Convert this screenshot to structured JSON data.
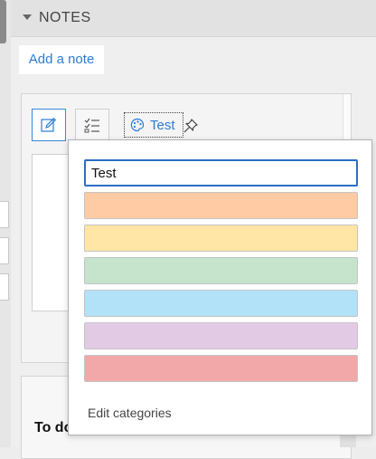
{
  "notes_panel": {
    "header_title": "NOTES",
    "add_note_label": "Add a note"
  },
  "note": {
    "tag_label": "Test"
  },
  "category_menu": {
    "name_value": "Test",
    "colors": [
      "#ffcba4",
      "#ffe6a6",
      "#c6e3cc",
      "#b2e2f8",
      "#e2cae5",
      "#f2a8a8"
    ],
    "edit_label": "Edit categories"
  },
  "todo": {
    "title": "To do"
  },
  "colors": {
    "accent": "#2b7cd3",
    "focus_border": "#2a6ec6"
  }
}
